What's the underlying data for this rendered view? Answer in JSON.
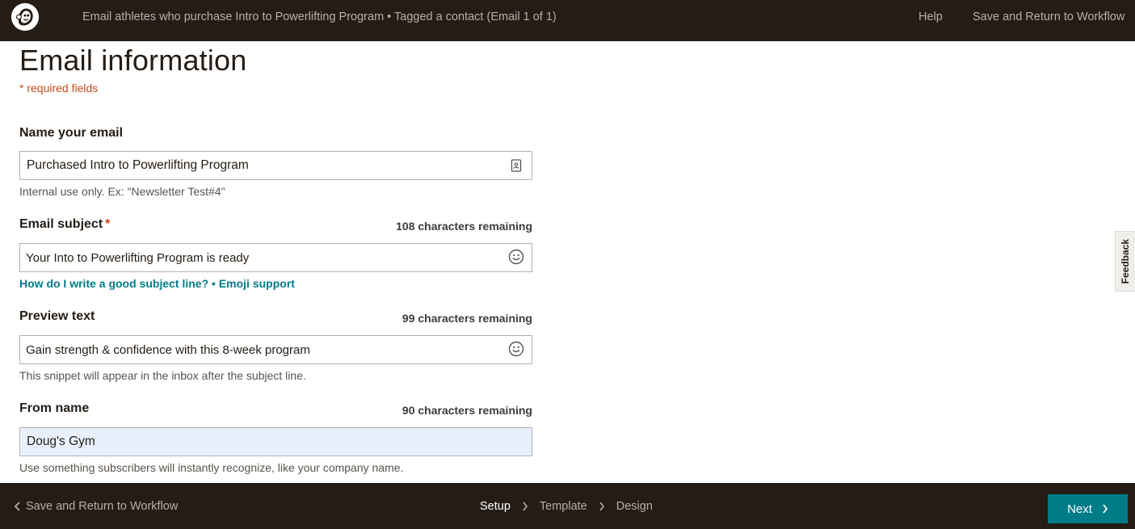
{
  "header": {
    "title": "Email athletes who purchase Intro to Powerlifting Program • Tagged a contact (Email 1 of 1)",
    "help_label": "Help",
    "save_label": "Save and Return to Workflow"
  },
  "page": {
    "title": "Email information",
    "required_note": "* required fields"
  },
  "fields": {
    "name": {
      "label": "Name your email",
      "value": "Purchased Intro to Powerlifting Program",
      "help": "Internal use only. Ex: \"Newsletter Test#4\""
    },
    "subject": {
      "label": "Email subject",
      "required_mark": "*",
      "count": "108 characters remaining",
      "value": "Your Into to Powerlifting Program is ready",
      "link1": "How do I write a good subject line?",
      "separator": "•",
      "link2": "Emoji support"
    },
    "preview": {
      "label": "Preview text",
      "count": "99 characters remaining",
      "value": "Gain strength & confidence with this 8-week program",
      "help": "This snippet will appear in the inbox after the subject line."
    },
    "from": {
      "label": "From name",
      "count": "90 characters remaining",
      "value": "Doug's Gym",
      "help": "Use something subscribers will instantly recognize, like your company name."
    }
  },
  "feedback_label": "Feedback",
  "footer": {
    "back_label": "Save and Return to Workflow",
    "steps": [
      "Setup",
      "Template",
      "Design"
    ],
    "active_step": "Setup",
    "next_label": "Next"
  },
  "colors": {
    "bar": "#241c15",
    "accent": "#007c89",
    "required": "#c14b1c"
  }
}
